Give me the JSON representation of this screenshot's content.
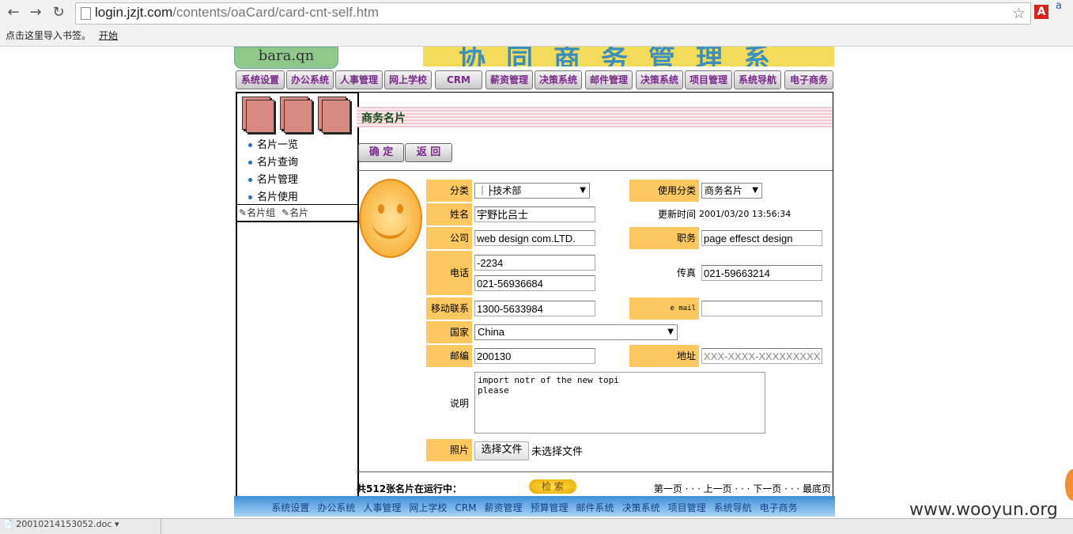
{
  "browser": {
    "url_host": "login.jzjt.com",
    "url_path": "/contents/oaCard/card-cnt-self.htm",
    "bookmarks_hint": "点击这里导入书签。",
    "bookmarks_start": "开始",
    "ext_letter": "A",
    "ext_badge": "a"
  },
  "header": {
    "logo_text": "bara.qn",
    "banner_text": "协同商务管理系统"
  },
  "top_nav": [
    "系统设置",
    "办公系统",
    "人事管理",
    "网上学校",
    "CRM",
    "薪资管理",
    "决策系统",
    "邮件管理",
    "决策系统",
    "项目管理",
    "系统导航",
    "电子商务"
  ],
  "sidebar": {
    "items": [
      "名片一览",
      "名片查询",
      "名片管理",
      "名片使用"
    ],
    "tab_group": "名片组",
    "tab_card": "名片"
  },
  "main": {
    "title": "商务名片",
    "confirm_label": "确 定",
    "back_label": "返 回"
  },
  "form": {
    "category_label": "分类",
    "category_value": "｜├技术部",
    "usage_label": "使用分类",
    "usage_value": "商务名片",
    "name_label": "姓名",
    "name_value": "宇野比吕士",
    "updated_label": "更新时间",
    "updated_value": "2001/03/20 13:56:34",
    "company_label": "公司",
    "company_value": "web design com.LTD.",
    "position_label": "职务",
    "position_value": "page effesct design",
    "phone_label": "电话",
    "phone_value_1": "-2234",
    "phone_value_2": "021-56936684",
    "fax_label": "传真",
    "fax_value": "021-59663214",
    "mobile_label": "移动联系",
    "mobile_value": "1300-5633984",
    "email_label": "e mail",
    "email_value": "",
    "country_label": "国家",
    "country_value": "China",
    "zip_label": "邮编",
    "zip_value": "200130",
    "address_label": "地址",
    "address_value": "XXX-XXXX-XXXXXXXXX",
    "note_label": "说明",
    "note_value": "import notr of the new topi\nplease",
    "photo_label": "照片",
    "file_button": "选择文件",
    "file_status": "未选择文件"
  },
  "footer_row": {
    "count_text": "共512张名片在运行中：",
    "search_label": "检 索",
    "pager": "第一页 · · · 上一页 · · · 下一页 · · · 最底页"
  },
  "bottom_nav": [
    "系统设置",
    "办公系统",
    "人事管理",
    "网上学校",
    "CRM",
    "薪资管理",
    "预算管理",
    "邮件系统",
    "决策系统",
    "项目管理",
    "系统导航",
    "电子商务"
  ],
  "status": {
    "download_item": "20010214153052.doc",
    "watermark": "www.wooyun.org"
  }
}
